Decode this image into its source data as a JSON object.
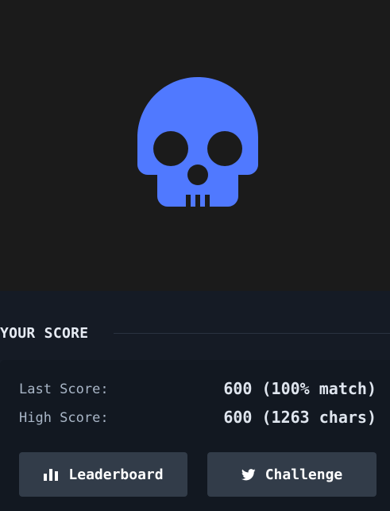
{
  "colors": {
    "skull": "#5079ff",
    "hero_bg": "#1b1b1b",
    "panel_bg": "#151b25",
    "button_bg": "#323c49"
  },
  "result": {
    "icon": "skull-icon"
  },
  "score_section": {
    "title": "YOUR SCORE",
    "last_score_label": "Last Score:",
    "last_score_value": "600 (100% match)",
    "high_score_label": "High Score:",
    "high_score_value": "600 (1263 chars)"
  },
  "buttons": {
    "leaderboard": {
      "label": "Leaderboard",
      "icon": "bar-chart-icon"
    },
    "challenge": {
      "label": "Challenge",
      "icon": "twitter-bird-icon"
    }
  }
}
